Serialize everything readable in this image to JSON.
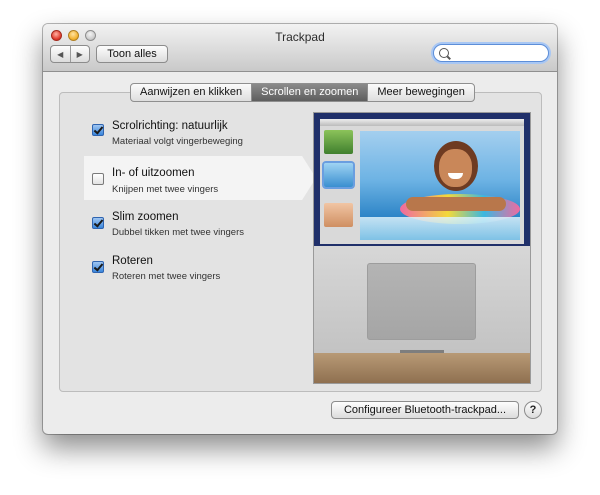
{
  "window": {
    "title": "Trackpad"
  },
  "toolbar": {
    "back_icon": "chevron-left-icon",
    "forward_icon": "chevron-right-icon",
    "show_all_label": "Toon alles",
    "search_value": "",
    "search_icon": "magnifier-icon"
  },
  "tabs": [
    {
      "label": "Aanwijzen en klikken",
      "selected": false
    },
    {
      "label": "Scrollen en zoomen",
      "selected": true
    },
    {
      "label": "Meer bewegingen",
      "selected": false
    }
  ],
  "options": [
    {
      "label": "Scrolrichting: natuurlijk",
      "sublabel": "Materiaal volgt vingerbeweging",
      "checked": true,
      "highlighted": false
    },
    {
      "label": "In- of uitzoomen",
      "sublabel": "Knijpen met twee vingers",
      "checked": false,
      "highlighted": true
    },
    {
      "label": "Slim zoomen",
      "sublabel": "Dubbel tikken met twee vingers",
      "checked": true,
      "highlighted": false
    },
    {
      "label": "Roteren",
      "sublabel": "Roteren met twee vingers",
      "checked": true,
      "highlighted": false
    }
  ],
  "footer": {
    "bluetooth_button_label": "Configureer Bluetooth-trackpad...",
    "help_label": "?"
  },
  "colors": {
    "selected_tab": "#6f6f6f",
    "checkbox_checked": "#3a86dc",
    "search_focus": "#5d8ed8"
  }
}
